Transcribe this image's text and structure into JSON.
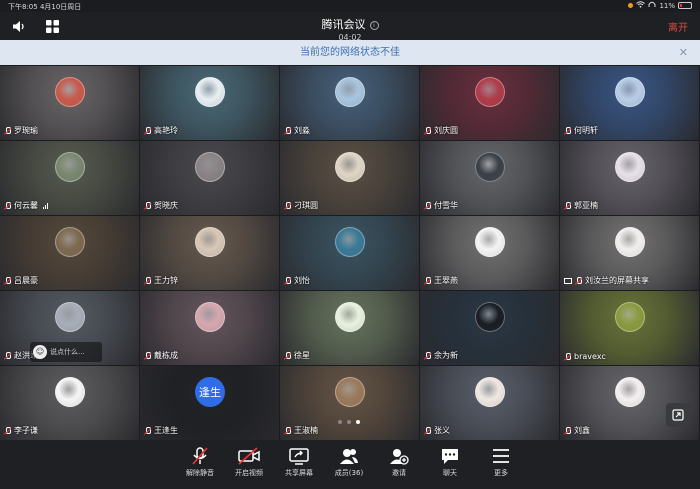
{
  "status": {
    "time_date": "下午8:05   4月10日周日",
    "battery": "11%"
  },
  "header": {
    "title": "腾讯会议",
    "timer": "04:02",
    "leave_label": "离开"
  },
  "banner": {
    "text": "当前您的网络状态不佳"
  },
  "participants": [
    {
      "name": "罗琬瑜",
      "bg": "#6e6a6c",
      "avatar_color": "#c85a4a"
    },
    {
      "name": "高艳玲",
      "bg": "#4d6f7d",
      "avatar_color": "#e8eef2"
    },
    {
      "name": "刘淼",
      "bg": "#4a6580",
      "avatar_color": "#a9c6de"
    },
    {
      "name": "刘庆圆",
      "bg": "#6e3040",
      "avatar_color": "#b03c4a"
    },
    {
      "name": "何明轩",
      "bg": "#3c5a8a",
      "avatar_color": "#b9cde6"
    },
    {
      "name": "何云馨",
      "bg": "#5a5f52",
      "avatar_color": "#7a8870"
    },
    {
      "name": "贺晓庆",
      "bg": "#4e4c50",
      "avatar_color": "#8a8486"
    },
    {
      "name": "刁琪圆",
      "bg": "#5f5448",
      "avatar_color": "#e0d6c8"
    },
    {
      "name": "付雪华",
      "bg": "#6a6c70",
      "avatar_color": "#3a4048"
    },
    {
      "name": "郭亚楠",
      "bg": "#6c6870",
      "avatar_color": "#e8e0ea"
    },
    {
      "name": "吕晨豪",
      "bg": "#5a4c3e",
      "avatar_color": "#7e6a50"
    },
    {
      "name": "王力锌",
      "bg": "#6c5e52",
      "avatar_color": "#d8c8b8"
    },
    {
      "name": "刘怡",
      "bg": "#3e5866",
      "avatar_color": "#3a7a98"
    },
    {
      "name": "王翠燕",
      "bg": "#787878",
      "avatar_color": "#f4f4f4"
    },
    {
      "name": "刘汝兰的屏幕共享",
      "bg": "#7a7878",
      "avatar_color": "#f2f0ee"
    },
    {
      "name": "赵洪靖",
      "bg": "#5a6068",
      "avatar_color": "#a8aeb8"
    },
    {
      "name": "戴栋成",
      "bg": "#6a5a62",
      "avatar_color": "#d6a8b0"
    },
    {
      "name": "徐星",
      "bg": "#6c7a62",
      "avatar_color": "#e8f0e0"
    },
    {
      "name": "余为新",
      "bg": "#2c3a48",
      "avatar_color": "#1a1e24"
    },
    {
      "name": "bravexc",
      "bg": "#6e7a3a",
      "avatar_color": "#8a9a40"
    },
    {
      "name": "李子谦",
      "bg": "#626264",
      "avatar_color": "#f6f6f6"
    },
    {
      "name": "王逢生",
      "bg": "#222326",
      "initial": "逢生"
    },
    {
      "name": "王淑楠",
      "bg": "#6a5848",
      "avatar_color": "#9a7a5a"
    },
    {
      "name": "张义",
      "bg": "#5e6470",
      "avatar_color": "#f0e8e0"
    },
    {
      "name": "刘鑫",
      "bg": "#6c6c70",
      "avatar_color": "#f4f0f0"
    }
  ],
  "typing_text": "说点什么...",
  "toolbar": [
    {
      "label": "解除静音",
      "icon": "mic-muted-icon"
    },
    {
      "label": "开启视频",
      "icon": "camera-off-icon"
    },
    {
      "label": "共享屏幕",
      "icon": "share-screen-icon"
    },
    {
      "label": "成员(36)",
      "icon": "members-icon"
    },
    {
      "label": "邀请",
      "icon": "invite-icon"
    },
    {
      "label": "聊天",
      "icon": "chat-icon"
    },
    {
      "label": "更多",
      "icon": "more-icon"
    }
  ]
}
